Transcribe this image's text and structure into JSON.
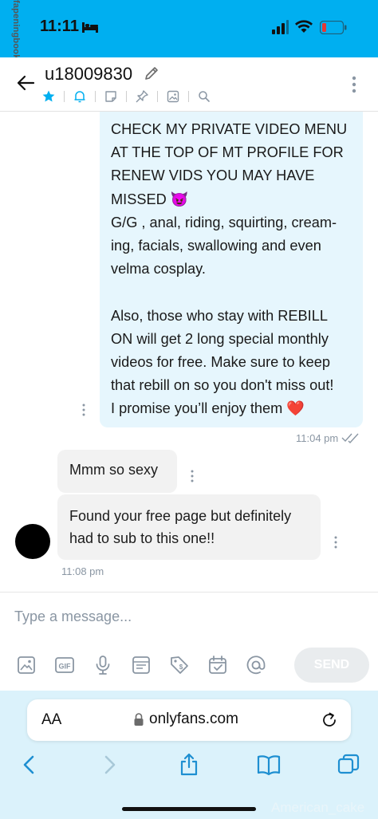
{
  "status_bar": {
    "time": "11:11",
    "watermark": "fapeningbook.com"
  },
  "header": {
    "username": "u18009830"
  },
  "messages": {
    "outgoing": {
      "text": "CHECK MY PRIVATE VIDEO MENU\nAT THE TOP OF MT PROFILE FOR\nRENEW VIDS YOU MAY HAVE\nMISSED 😈\nG/G , anal, riding, squirting, cream-\ning, facials, swallowing and even\nvelma cosplay.\n\nAlso, those who stay with REBILL\nON will get 2 long special monthly\nvideos for free. Make sure to keep\nthat rebill on so you don't miss out!\nI promise you’ll enjoy them ❤️",
      "time": "11:04 pm"
    },
    "incoming": [
      {
        "text": "Mmm so sexy"
      },
      {
        "text": "Found your free page but definitely\nhad to sub to this one!!"
      }
    ],
    "incoming_time": "11:08 pm"
  },
  "composer": {
    "placeholder": "Type a message...",
    "send_label": "SEND",
    "gif_label": "GIF"
  },
  "browser": {
    "aa_label": "AA",
    "url": "onlyfans.com",
    "watermark": "American_cake"
  },
  "colors": {
    "brand": "#00aff0",
    "outgoing_bubble": "#e6f6fd",
    "incoming_bubble": "#f2f2f2",
    "browser_bar": "#dbf2fb"
  }
}
